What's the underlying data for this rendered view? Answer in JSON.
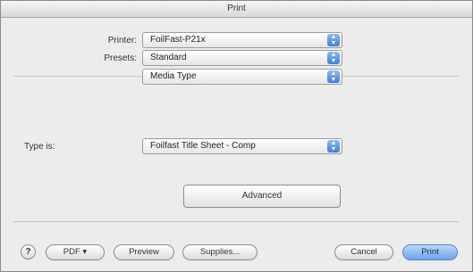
{
  "window": {
    "title": "Print"
  },
  "printer": {
    "label": "Printer:",
    "value": "FoilFast-P21x"
  },
  "presets": {
    "label": "Presets:",
    "value": "Standard"
  },
  "panel": {
    "value": "Media Type"
  },
  "media": {
    "label": "Type is:",
    "value": "Foilfast Title Sheet - Comp"
  },
  "advanced_label": "Advanced",
  "footer": {
    "help": "?",
    "pdf": "PDF ▾",
    "preview": "Preview",
    "supplies": "Supplies...",
    "cancel": "Cancel",
    "print": "Print"
  },
  "icons": {
    "popup_arrows": "updown-arrows-icon",
    "help": "question-mark-icon"
  },
  "colors": {
    "accent": "#3d7fd6",
    "background": "#ececec"
  }
}
